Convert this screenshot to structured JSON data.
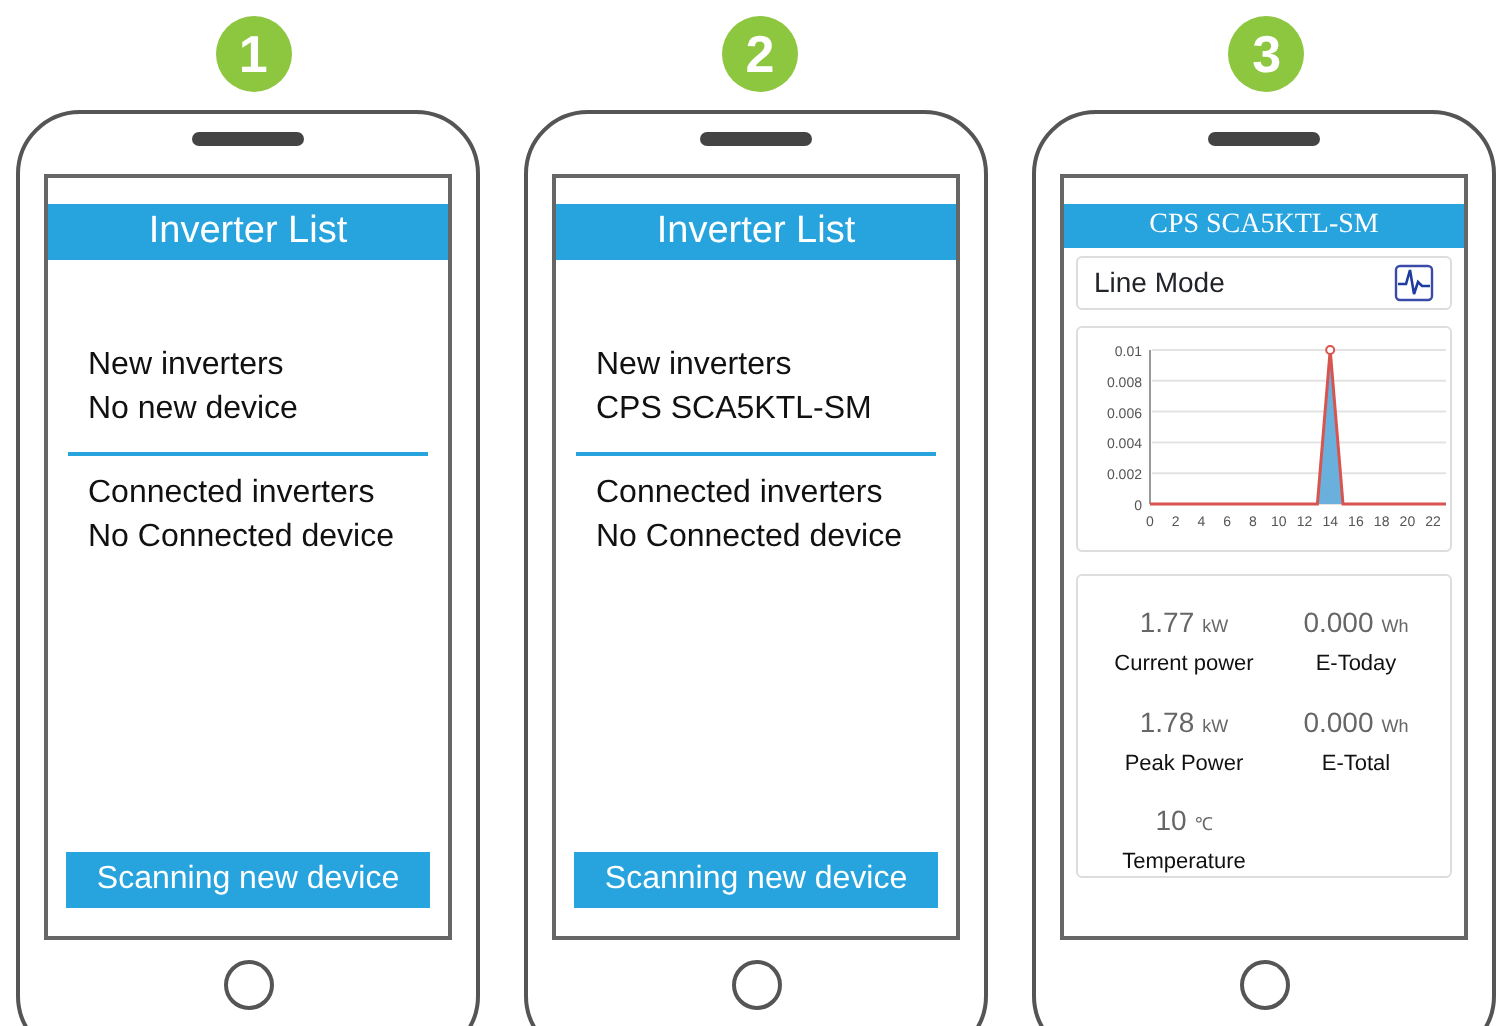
{
  "step_badges": [
    "1",
    "2",
    "3"
  ],
  "phones": [
    {
      "kind": "list",
      "title": "Inverter List",
      "sections": [
        {
          "heading": "New inverters",
          "value": "No new device"
        },
        {
          "heading": "Connected inverters",
          "value": "No Connected device"
        }
      ],
      "button": "Scanning new device"
    },
    {
      "kind": "list",
      "title": "Inverter List",
      "sections": [
        {
          "heading": "New inverters",
          "value": "CPS SCA5KTL-SM"
        },
        {
          "heading": "Connected inverters",
          "value": "No Connected device"
        }
      ],
      "button": "Scanning new device"
    },
    {
      "kind": "detail",
      "title": "CPS SCA5KTL-SM",
      "mode": "Line Mode",
      "chart_data": {
        "type": "area",
        "x": [
          0,
          1,
          2,
          3,
          4,
          5,
          6,
          7,
          8,
          9,
          10,
          11,
          12,
          13,
          14,
          15,
          16,
          17,
          18,
          19,
          20,
          21,
          22,
          23
        ],
        "grid": true,
        "series": [
          {
            "color": "#6ab0dc",
            "values": [
              0,
              0,
              0,
              0,
              0,
              0,
              0,
              0,
              0,
              0,
              0,
              0,
              0,
              0,
              0.01,
              0,
              0,
              0,
              0,
              0,
              0,
              0,
              0,
              0
            ]
          }
        ],
        "xlim": [
          0,
          23
        ],
        "ylim": [
          0,
          0.01
        ],
        "xticks": [
          0,
          2,
          4,
          6,
          8,
          10,
          12,
          14,
          16,
          18,
          20,
          22
        ],
        "yticks": [
          {
            "value": 0,
            "label": "0"
          },
          {
            "value": 0.002,
            "label": "0.002"
          },
          {
            "value": 0.004,
            "label": "0.004"
          },
          {
            "value": 0.006,
            "label": "0.006"
          },
          {
            "value": 0.008,
            "label": "0.008"
          },
          {
            "value": 0.01,
            "label": "0.01"
          }
        ]
      },
      "stats": [
        {
          "value": "1.77",
          "unit": "kW",
          "label": "Current power"
        },
        {
          "value": "0.000",
          "unit": "Wh",
          "label": "E-Today"
        },
        {
          "value": "1.78",
          "unit": "kW",
          "label": "Peak Power"
        },
        {
          "value": "0.000",
          "unit": "Wh",
          "label": "E-Total"
        },
        {
          "value": "10",
          "unit": "℃",
          "label": "Temperature"
        }
      ]
    }
  ]
}
